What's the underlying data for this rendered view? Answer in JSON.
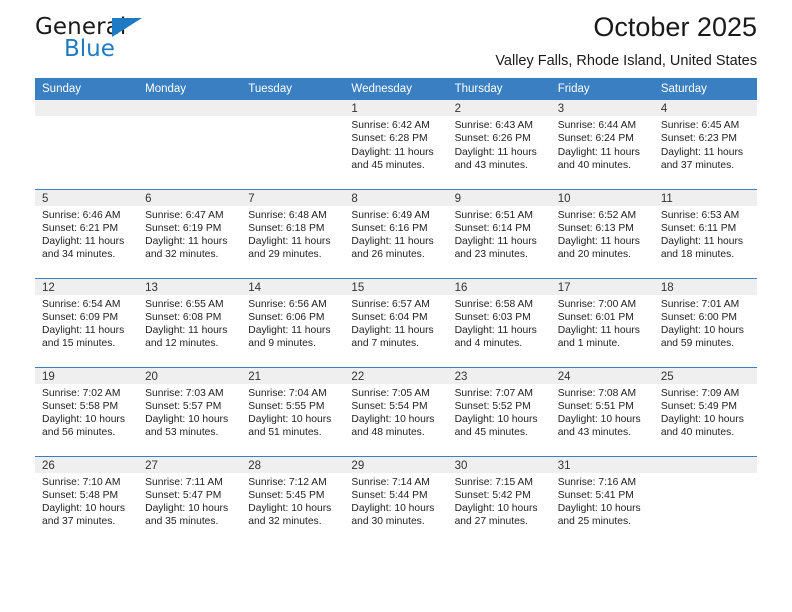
{
  "brand": {
    "name_part1": "General",
    "name_part2": "Blue",
    "icon": "triangle-logo-icon",
    "color": "#1f7ac4"
  },
  "header": {
    "title": "October 2025",
    "subtitle": "Valley Falls, Rhode Island, United States"
  },
  "theme": {
    "header_bg": "#3a7fc1",
    "daynum_bg": "#efefef",
    "text": "#222222"
  },
  "weekdays": [
    "Sunday",
    "Monday",
    "Tuesday",
    "Wednesday",
    "Thursday",
    "Friday",
    "Saturday"
  ],
  "labels": {
    "sunrise": "Sunrise:",
    "sunset": "Sunset:",
    "daylight": "Daylight:"
  },
  "weeks": [
    [
      {
        "day": "",
        "blank": true
      },
      {
        "day": "",
        "blank": true
      },
      {
        "day": "",
        "blank": true
      },
      {
        "day": "1",
        "sunrise": "Sunrise: 6:42 AM",
        "sunset": "Sunset: 6:28 PM",
        "daylight": "Daylight: 11 hours and 45 minutes."
      },
      {
        "day": "2",
        "sunrise": "Sunrise: 6:43 AM",
        "sunset": "Sunset: 6:26 PM",
        "daylight": "Daylight: 11 hours and 43 minutes."
      },
      {
        "day": "3",
        "sunrise": "Sunrise: 6:44 AM",
        "sunset": "Sunset: 6:24 PM",
        "daylight": "Daylight: 11 hours and 40 minutes."
      },
      {
        "day": "4",
        "sunrise": "Sunrise: 6:45 AM",
        "sunset": "Sunset: 6:23 PM",
        "daylight": "Daylight: 11 hours and 37 minutes."
      }
    ],
    [
      {
        "day": "5",
        "sunrise": "Sunrise: 6:46 AM",
        "sunset": "Sunset: 6:21 PM",
        "daylight": "Daylight: 11 hours and 34 minutes."
      },
      {
        "day": "6",
        "sunrise": "Sunrise: 6:47 AM",
        "sunset": "Sunset: 6:19 PM",
        "daylight": "Daylight: 11 hours and 32 minutes."
      },
      {
        "day": "7",
        "sunrise": "Sunrise: 6:48 AM",
        "sunset": "Sunset: 6:18 PM",
        "daylight": "Daylight: 11 hours and 29 minutes."
      },
      {
        "day": "8",
        "sunrise": "Sunrise: 6:49 AM",
        "sunset": "Sunset: 6:16 PM",
        "daylight": "Daylight: 11 hours and 26 minutes."
      },
      {
        "day": "9",
        "sunrise": "Sunrise: 6:51 AM",
        "sunset": "Sunset: 6:14 PM",
        "daylight": "Daylight: 11 hours and 23 minutes."
      },
      {
        "day": "10",
        "sunrise": "Sunrise: 6:52 AM",
        "sunset": "Sunset: 6:13 PM",
        "daylight": "Daylight: 11 hours and 20 minutes."
      },
      {
        "day": "11",
        "sunrise": "Sunrise: 6:53 AM",
        "sunset": "Sunset: 6:11 PM",
        "daylight": "Daylight: 11 hours and 18 minutes."
      }
    ],
    [
      {
        "day": "12",
        "sunrise": "Sunrise: 6:54 AM",
        "sunset": "Sunset: 6:09 PM",
        "daylight": "Daylight: 11 hours and 15 minutes."
      },
      {
        "day": "13",
        "sunrise": "Sunrise: 6:55 AM",
        "sunset": "Sunset: 6:08 PM",
        "daylight": "Daylight: 11 hours and 12 minutes."
      },
      {
        "day": "14",
        "sunrise": "Sunrise: 6:56 AM",
        "sunset": "Sunset: 6:06 PM",
        "daylight": "Daylight: 11 hours and 9 minutes."
      },
      {
        "day": "15",
        "sunrise": "Sunrise: 6:57 AM",
        "sunset": "Sunset: 6:04 PM",
        "daylight": "Daylight: 11 hours and 7 minutes."
      },
      {
        "day": "16",
        "sunrise": "Sunrise: 6:58 AM",
        "sunset": "Sunset: 6:03 PM",
        "daylight": "Daylight: 11 hours and 4 minutes."
      },
      {
        "day": "17",
        "sunrise": "Sunrise: 7:00 AM",
        "sunset": "Sunset: 6:01 PM",
        "daylight": "Daylight: 11 hours and 1 minute."
      },
      {
        "day": "18",
        "sunrise": "Sunrise: 7:01 AM",
        "sunset": "Sunset: 6:00 PM",
        "daylight": "Daylight: 10 hours and 59 minutes."
      }
    ],
    [
      {
        "day": "19",
        "sunrise": "Sunrise: 7:02 AM",
        "sunset": "Sunset: 5:58 PM",
        "daylight": "Daylight: 10 hours and 56 minutes."
      },
      {
        "day": "20",
        "sunrise": "Sunrise: 7:03 AM",
        "sunset": "Sunset: 5:57 PM",
        "daylight": "Daylight: 10 hours and 53 minutes."
      },
      {
        "day": "21",
        "sunrise": "Sunrise: 7:04 AM",
        "sunset": "Sunset: 5:55 PM",
        "daylight": "Daylight: 10 hours and 51 minutes."
      },
      {
        "day": "22",
        "sunrise": "Sunrise: 7:05 AM",
        "sunset": "Sunset: 5:54 PM",
        "daylight": "Daylight: 10 hours and 48 minutes."
      },
      {
        "day": "23",
        "sunrise": "Sunrise: 7:07 AM",
        "sunset": "Sunset: 5:52 PM",
        "daylight": "Daylight: 10 hours and 45 minutes."
      },
      {
        "day": "24",
        "sunrise": "Sunrise: 7:08 AM",
        "sunset": "Sunset: 5:51 PM",
        "daylight": "Daylight: 10 hours and 43 minutes."
      },
      {
        "day": "25",
        "sunrise": "Sunrise: 7:09 AM",
        "sunset": "Sunset: 5:49 PM",
        "daylight": "Daylight: 10 hours and 40 minutes."
      }
    ],
    [
      {
        "day": "26",
        "sunrise": "Sunrise: 7:10 AM",
        "sunset": "Sunset: 5:48 PM",
        "daylight": "Daylight: 10 hours and 37 minutes."
      },
      {
        "day": "27",
        "sunrise": "Sunrise: 7:11 AM",
        "sunset": "Sunset: 5:47 PM",
        "daylight": "Daylight: 10 hours and 35 minutes."
      },
      {
        "day": "28",
        "sunrise": "Sunrise: 7:12 AM",
        "sunset": "Sunset: 5:45 PM",
        "daylight": "Daylight: 10 hours and 32 minutes."
      },
      {
        "day": "29",
        "sunrise": "Sunrise: 7:14 AM",
        "sunset": "Sunset: 5:44 PM",
        "daylight": "Daylight: 10 hours and 30 minutes."
      },
      {
        "day": "30",
        "sunrise": "Sunrise: 7:15 AM",
        "sunset": "Sunset: 5:42 PM",
        "daylight": "Daylight: 10 hours and 27 minutes."
      },
      {
        "day": "31",
        "sunrise": "Sunrise: 7:16 AM",
        "sunset": "Sunset: 5:41 PM",
        "daylight": "Daylight: 10 hours and 25 minutes."
      },
      {
        "day": "",
        "blank": true
      }
    ]
  ]
}
